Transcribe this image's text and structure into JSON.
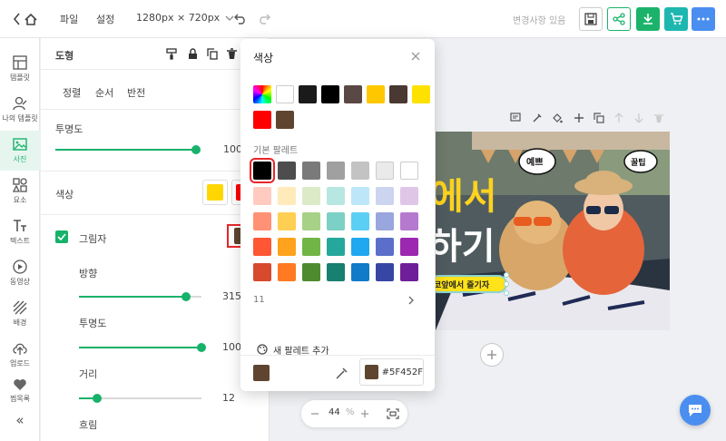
{
  "topbar": {
    "file_label": "파일",
    "settings_label": "설정",
    "size_label": "1280px × 720px",
    "save_status": "변경사항 있음",
    "colors": {
      "green": "#1bb36b",
      "blue": "#4a8ef0"
    }
  },
  "leftnav": {
    "items": [
      {
        "label": "템플릿",
        "icon": "template-icon"
      },
      {
        "label": "나의 템플릿",
        "icon": "my-template-icon"
      },
      {
        "label": "사진",
        "icon": "photo-icon",
        "active": true
      },
      {
        "label": "요소",
        "icon": "elements-icon"
      },
      {
        "label": "텍스트",
        "icon": "text-icon"
      },
      {
        "label": "동영상",
        "icon": "video-icon"
      },
      {
        "label": "배경",
        "icon": "background-icon"
      },
      {
        "label": "업로드",
        "icon": "upload-icon"
      },
      {
        "label": "찜목록",
        "icon": "heart-icon"
      }
    ],
    "collapse_glyph": "«"
  },
  "panel": {
    "title": "도형",
    "tabs": [
      "정렬",
      "순서",
      "반전"
    ],
    "opacity": {
      "label": "투명도",
      "value": "100",
      "level": 1.0
    },
    "color_label": "색상",
    "color_swatch_1": "#ffd600",
    "color_swatch_2": "#ff0000",
    "shadow": {
      "label": "그림자",
      "checked": true,
      "swatch_color": "#5F452F",
      "direction": {
        "label": "방향",
        "value": "315",
        "level": 0.875
      },
      "opacity": {
        "label": "투명도",
        "value": "100",
        "level": 1.0
      },
      "distance": {
        "label": "거리",
        "value": "12",
        "level": 0.15
      },
      "blur_label": "흐림"
    }
  },
  "popup": {
    "title": "색상",
    "recent_colors": [
      "gradient",
      "#ffffff",
      "#1a1a1a",
      "#000000",
      "#5a4844",
      "#ffc700",
      "#4a3833",
      "#ffe100",
      "#ff0000",
      "#5f452f"
    ],
    "basic_palette_label": "기본 팔레트",
    "basic_palette": [
      [
        "#000000",
        "#4d4d4d",
        "#7a7a7a",
        "#a0a0a0",
        "#c3c3c3",
        "#eaeaea",
        "#ffffff"
      ],
      [
        "#ffcbc0",
        "#ffeaba",
        "#dceac8",
        "#b8e7e2",
        "#bde7f8",
        "#ccd4ef",
        "#dfc6e7"
      ],
      [
        "#ff9275",
        "#ffcf54",
        "#a7d187",
        "#7dd0c5",
        "#5ccff5",
        "#9aa6de",
        "#b57ad0"
      ],
      [
        "#ff5634",
        "#ffa21d",
        "#72b547",
        "#24a89b",
        "#1fa8ef",
        "#5b6fca",
        "#9c27b0"
      ],
      [
        "#d84a2e",
        "#ff7a22",
        "#4e8b2e",
        "#178070",
        "#0f7bc9",
        "#3746a5",
        "#6f1e99"
      ]
    ],
    "page_count": "11",
    "add_palette_label": "새 팔레트 추가",
    "current_color": "#5F452F",
    "hex_value": "#5F452F"
  },
  "canvas": {
    "title_text_1": "에서",
    "title_text_2": "하기",
    "bubble_1": "예쁘",
    "bubble_2": "꿀팁",
    "banner_text": "코앞에서 즐기자"
  },
  "zoom": {
    "value": "44",
    "unit": "%"
  }
}
